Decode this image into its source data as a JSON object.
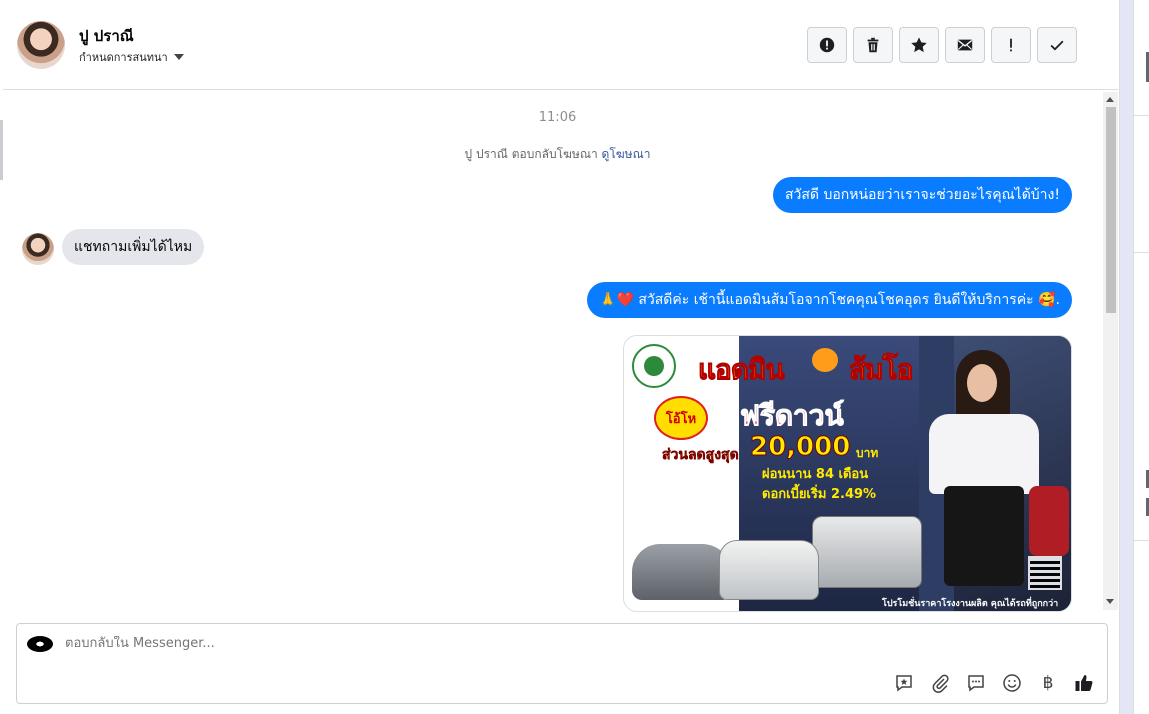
{
  "header": {
    "name": "ปู ปราณี",
    "subtitle": "กำหนดการสนทนา",
    "toolbar": [
      "report-icon",
      "trash-icon",
      "star-icon",
      "mail-icon",
      "exclamation-icon",
      "check-icon"
    ]
  },
  "conversation": {
    "time": "11:06",
    "reply_note_prefix": "ปู ปราณี ตอบกลับโฆษณา",
    "reply_note_link": "ดูโฆษณา",
    "messages": [
      {
        "direction": "out",
        "text": "สวัสดี บอกหน่อยว่าเราจะช่วยอะไรคุณได้บ้าง!"
      },
      {
        "direction": "in",
        "text": "แชทถามเพิ่มได้ไหม"
      },
      {
        "direction": "out",
        "text": "🙏❤️ สวัสดีค่ะ เช้านี้แอดมินส้มโอจากโชคคุณโชคอุดร ยินดีให้บริการค่ะ 🥰."
      }
    ],
    "ad_image": {
      "headline_1": "แอดมิน",
      "headline_2": "ส้มโอ",
      "burst": "โอ้โห",
      "free_down": "ฟรีดาวน์",
      "discount_label": "ส่วนลดสูงสุด",
      "discount_value": "20,000",
      "discount_unit": "บาท",
      "installment": "ผ่อนนาน 84 เดือน",
      "interest": "ดอกเบี้ยเริ่ม 2.49%",
      "footer": "โปรโมชั่นราคาโรงงานผลิต คุณได้รถที่ถูกกว่า"
    }
  },
  "composer": {
    "placeholder": "ตอบกลับใน Messenger...",
    "icons": [
      "quick-reply-icon",
      "attach-icon",
      "saved-reply-icon",
      "emoji-icon",
      "baht-icon",
      "like-icon"
    ],
    "baht_symbol": "฿"
  },
  "colors": {
    "accent": "#0a7cff",
    "bubble_in": "#e4e6eb",
    "border": "#dadde1"
  }
}
